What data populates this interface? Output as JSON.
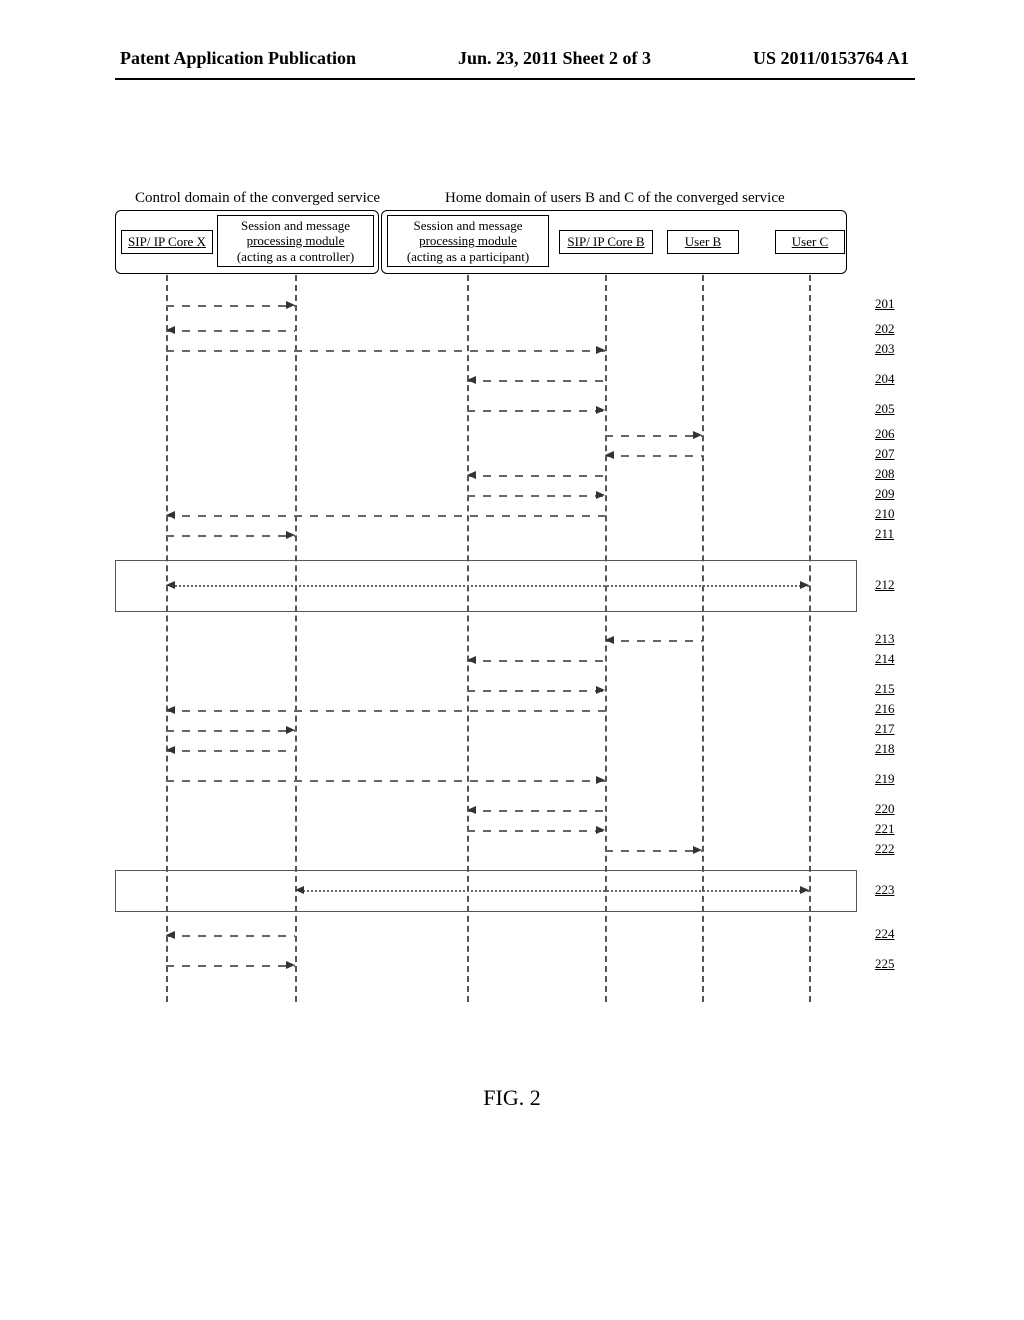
{
  "header": {
    "left": "Patent Application Publication",
    "center": "Jun. 23, 2011  Sheet 2 of 3",
    "right": "US 2011/0153764 A1"
  },
  "domains": {
    "control": "Control domain of the converged service",
    "home": "Home domain of users B and C of the converged service"
  },
  "actors": {
    "sipx": "SIP/ IP Core X",
    "controller1": "Session and message",
    "controller2": "processing module",
    "controller3": "(acting as a controller)",
    "participant1": "Session and message",
    "participant2": "processing module",
    "participant3": "(acting as a participant)",
    "sipb": "SIP/ IP Core B",
    "userb": "User B",
    "userc": "User C"
  },
  "steps": {
    "s201": "201",
    "s202": "202",
    "s203": "203",
    "s204": "204",
    "s205": "205",
    "s206": "206",
    "s207": "207",
    "s208": "208",
    "s209": "209",
    "s210": "210",
    "s211": "211",
    "s212": "212",
    "s213": "213",
    "s214": "214",
    "s215": "215",
    "s216": "216",
    "s217": "217",
    "s218": "218",
    "s219": "219",
    "s220": "220",
    "s221": "221",
    "s222": "222",
    "s223": "223",
    "s224": "224",
    "s225": "225"
  },
  "figure": "FIG. 2"
}
